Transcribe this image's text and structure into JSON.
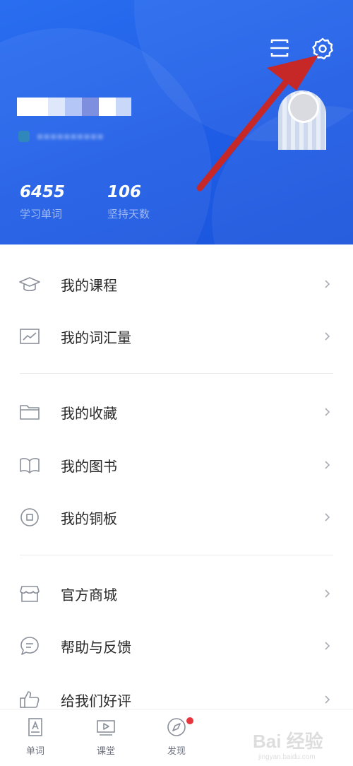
{
  "header": {
    "stats": [
      {
        "value": "6455",
        "label": "学习单词"
      },
      {
        "value": "106",
        "label": "坚持天数"
      }
    ]
  },
  "menu": [
    {
      "label": "我的课程",
      "icon": "graduation-cap-icon"
    },
    {
      "label": "我的词汇量",
      "icon": "chart-icon"
    },
    {
      "label": "我的收藏",
      "icon": "folder-icon"
    },
    {
      "label": "我的图书",
      "icon": "book-icon"
    },
    {
      "label": "我的铜板",
      "icon": "coin-icon"
    },
    {
      "label": "官方商城",
      "icon": "store-icon"
    },
    {
      "label": "帮助与反馈",
      "icon": "chat-icon"
    },
    {
      "label": "给我们好评",
      "icon": "thumbs-up-icon"
    }
  ],
  "tabbar": [
    {
      "label": "单词",
      "icon": "word-card-icon"
    },
    {
      "label": "课堂",
      "icon": "video-icon"
    },
    {
      "label": "发现",
      "icon": "compass-icon",
      "badge": true
    }
  ],
  "colors": {
    "header_blue": "#1f5de6",
    "annotation_arrow": "#c62828",
    "badge_red": "#e8343c"
  },
  "watermark": {
    "text": "Bai 经验",
    "subtext": "jingyan.baidu.com"
  }
}
